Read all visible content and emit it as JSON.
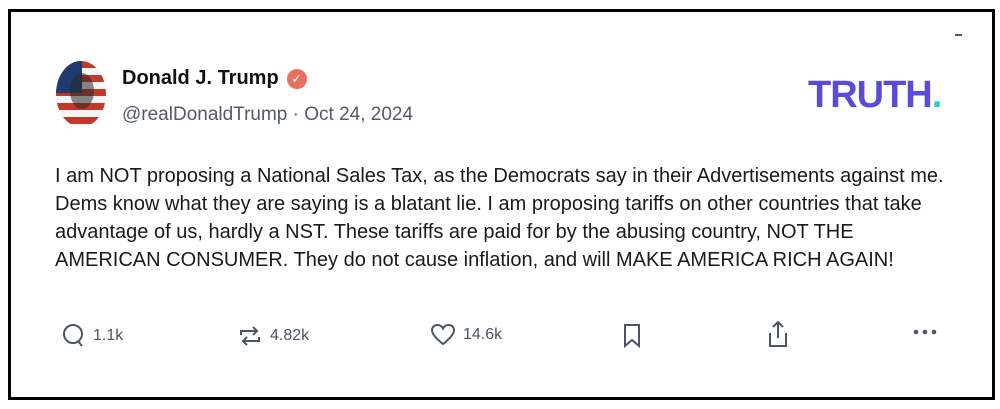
{
  "post": {
    "author_name": "Donald J. Trump",
    "verified_icon": "verified-badge-icon",
    "handle": "@realDonaldTrump",
    "separator": "·",
    "date": "Oct 24, 2024",
    "text": "I am NOT proposing a National Sales Tax, as the Democrats say in their Advertisements against me. Dems know what they are saying is a blatant lie. I am proposing tariffs on other countries that take advantage of us, hardly a NST. These tariffs are paid for by the abusing country, NOT THE AMERICAN CONSUMER. They do not cause inflation, and will MAKE AMERICA RICH AGAIN!"
  },
  "brand": {
    "logo_text": "TRUTH",
    "logo_dot": ".",
    "logo_color": "#5b4bdb",
    "dot_color": "#2ed3b7"
  },
  "actions": {
    "replies": "1.1k",
    "retruths": "4.82k",
    "likes": "14.6k",
    "icons": [
      "reply-icon",
      "retruth-icon",
      "like-icon",
      "bookmark-icon",
      "share-icon",
      "more-icon"
    ]
  }
}
